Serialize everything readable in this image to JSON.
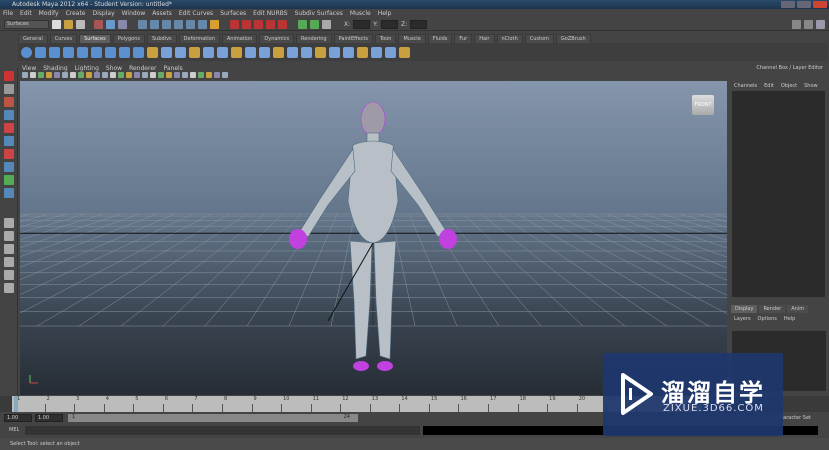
{
  "title": "Autodesk Maya 2012 x64 - Student Version: untitled*",
  "menus": [
    "File",
    "Edit",
    "Modify",
    "Create",
    "Display",
    "Window",
    "Assets",
    "Edit Curves",
    "Surfaces",
    "Edit NURBS",
    "Subdiv Surfaces",
    "Muscle",
    "Help"
  ],
  "mode": "Surfaces",
  "xyz": [
    "X:",
    "Y:",
    "Z:"
  ],
  "shelf_tabs": [
    "General",
    "Curves",
    "Surfaces",
    "Polygons",
    "Subdivs",
    "Deformation",
    "Animation",
    "Dynamics",
    "Rendering",
    "PaintEffects",
    "Toon",
    "Muscle",
    "Fluids",
    "Fur",
    "Hair",
    "nCloth",
    "Custom",
    "GoZBrush"
  ],
  "active_shelf": "Surfaces",
  "panel_menus": [
    "View",
    "Shading",
    "Lighting",
    "Show",
    "Renderer",
    "Panels"
  ],
  "view_cube": "FRONT",
  "channel_box": {
    "header": "Channel Box / Layer Editor",
    "menus": [
      "Channels",
      "Edit",
      "Object",
      "Show"
    ]
  },
  "layer_editor": {
    "tabs": [
      "Display",
      "Render",
      "Anim"
    ],
    "menus": [
      "Layers",
      "Options",
      "Help"
    ]
  },
  "timeline": {
    "start": 1,
    "end": 24,
    "current": 1
  },
  "range": {
    "start": "1.00",
    "anim_start": "1.00",
    "slider_start": "1",
    "slider_end": "24"
  },
  "character_set": "Character Set",
  "mel_label": "MEL",
  "status": "Select Tool: select an object",
  "watermark": {
    "cn": "溜溜自学",
    "en": "ZIXUE.3D66.COM"
  },
  "colors": {
    "accent": "#5a8fd0",
    "select": "#c040e0"
  }
}
